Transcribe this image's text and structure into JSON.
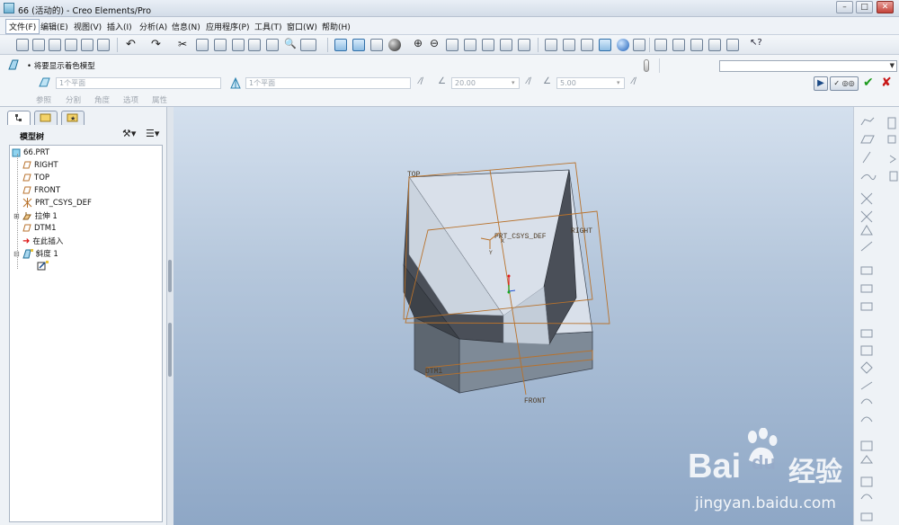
{
  "window": {
    "title": "66 (活动的) - Creo Elements/Pro",
    "controls": [
      "minimize",
      "maximize",
      "close"
    ]
  },
  "menu": {
    "items": [
      "文件(F)",
      "编辑(E)",
      "视图(V)",
      "插入(I)",
      "分析(A)",
      "信息(N)",
      "应用程序(P)",
      "工具(T)",
      "窗口(W)",
      "帮助(H)"
    ]
  },
  "dashboard": {
    "message": "• 将要显示着色模型",
    "reference1_placeholder": "1个平面",
    "reference2_placeholder": "1个平面",
    "angle1_value": "20.00",
    "angle2_value": "5.00",
    "tabs": [
      "参照",
      "分割",
      "角度",
      "选项",
      "属性"
    ],
    "filter_value": ""
  },
  "model_tree": {
    "title": "模型树",
    "items": [
      {
        "label": "66.PRT",
        "icon": "part-icon"
      },
      {
        "label": "RIGHT",
        "icon": "datum-plane-icon"
      },
      {
        "label": "TOP",
        "icon": "datum-plane-icon"
      },
      {
        "label": "FRONT",
        "icon": "datum-plane-icon"
      },
      {
        "label": "PRT_CSYS_DEF",
        "icon": "csys-icon"
      },
      {
        "label": "拉伸 1",
        "icon": "extrude-icon"
      },
      {
        "label": "DTM1",
        "icon": "datum-plane-icon"
      },
      {
        "label": "在此插入",
        "icon": "insert-here-icon"
      },
      {
        "label": "斜度 1",
        "icon": "draft-icon"
      },
      {
        "label": "",
        "icon": "edit-feature-icon"
      }
    ]
  },
  "graphics": {
    "labels": {
      "top": "TOP",
      "right": "RIGHT",
      "front": "FRONT",
      "dtm1": "DTM1",
      "csys": "PRT_CSYS_DEF"
    }
  },
  "watermark": {
    "brand_text": "Bai",
    "brand_text2": "du",
    "brand_cn": "经验",
    "url": "jingyan.baidu.com"
  },
  "colors": {
    "datum_orange": "#b8722c",
    "model_face": "#d9e0ea",
    "model_dark": "#4a4f58",
    "accept_green": "#1c9a1c",
    "cancel_red": "#c81818"
  }
}
